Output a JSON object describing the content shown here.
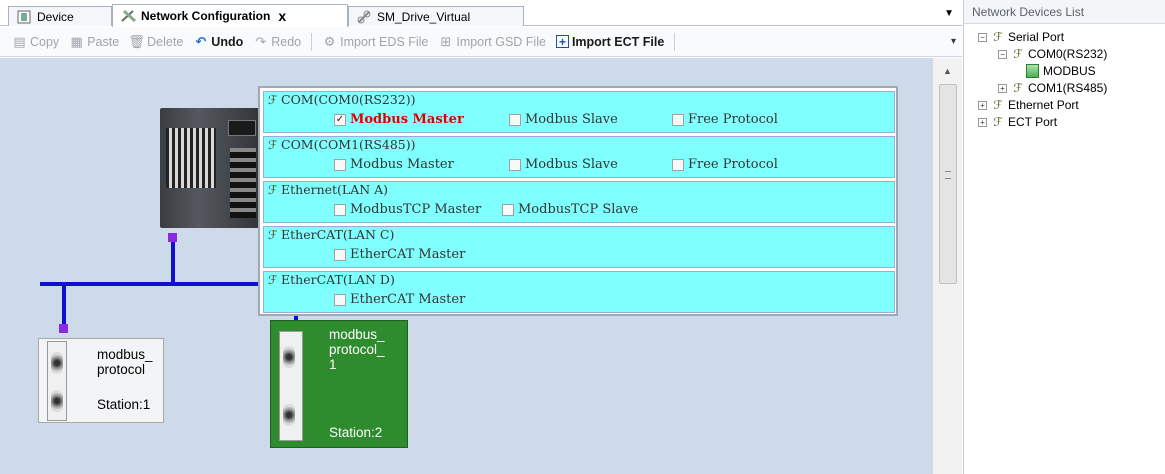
{
  "tabs": [
    {
      "label": "Device",
      "icon": "device-icon"
    },
    {
      "label": "Network Configuration",
      "icon": "network-config-icon",
      "close": "x"
    },
    {
      "label": "SM_Drive_Virtual",
      "icon": "link-icon"
    }
  ],
  "tab_overflow": "▼",
  "toolbar": {
    "copy": "Copy",
    "paste": "Paste",
    "delete": "Delete",
    "undo": "Undo",
    "redo": "Redo",
    "import_eds": "Import EDS File",
    "import_gsd": "Import GSD File",
    "import_ect": "Import ECT File"
  },
  "devices": {
    "card1": {
      "name": "modbus_\nprotocol",
      "station": "Station:1"
    },
    "card2": {
      "name": "modbus_\nprotocol_\n1",
      "station": "Station:2"
    }
  },
  "config": {
    "com0": {
      "title": "COM(COM0(RS232))",
      "opt1": "Modbus Master",
      "opt2": "Modbus Slave",
      "opt3": "Free Protocol"
    },
    "com1": {
      "title": "COM(COM1(RS485))",
      "opt1": "Modbus Master",
      "opt2": "Modbus Slave",
      "opt3": "Free Protocol"
    },
    "lan_a": {
      "title": "Ethernet(LAN A)",
      "opt1": "ModbusTCP Master",
      "opt2": "ModbusTCP Slave"
    },
    "lan_c": {
      "title": "EtherCAT(LAN C)",
      "opt1": "EtherCAT Master"
    },
    "lan_d": {
      "title": "EtherCAT(LAN D)",
      "opt1": "EtherCAT Master"
    },
    "checked": "com0.opt1"
  },
  "panel": {
    "title": "Network Devices List",
    "tree": {
      "serial": "Serial Port",
      "com0": "COM0(RS232)",
      "modbus": "MODBUS",
      "com1": "COM1(RS485)",
      "ethernet": "Ethernet Port",
      "ect": "ECT Port"
    }
  },
  "colors": {
    "canvas": "#ccdae9",
    "bus": "#1010d0",
    "node": "#8a2be2",
    "config_row": "#80ffff",
    "selected_device": "#2e8b2e",
    "checked_label": "#e00000"
  }
}
